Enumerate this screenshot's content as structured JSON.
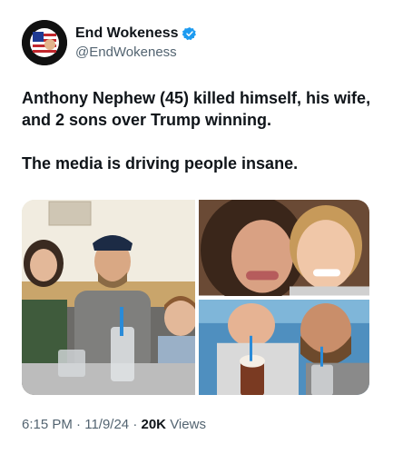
{
  "author": {
    "display_name": "End Wokeness",
    "handle": "@EndWokeness",
    "avatar_ring_text_top": "SUPPORT OUR",
    "avatar_ring_text_bottom": "FORMER TRUMP",
    "verified_color": "#1d9bf0"
  },
  "tweet": {
    "line1": "Anthony Nephew (45) killed himself, his wife, and 2 sons over Trump winning.",
    "line2": "The media is driving people insane."
  },
  "media": {
    "photos": [
      "photo-family-diner",
      "photo-mother-son-selfie",
      "photo-father-son-milkshake"
    ]
  },
  "meta": {
    "time": "6:15 PM",
    "separator": "·",
    "date": "11/9/24",
    "views_count": "20K",
    "views_label": "Views"
  },
  "colors": {
    "text_primary": "#0f1419",
    "text_secondary": "#536471"
  }
}
